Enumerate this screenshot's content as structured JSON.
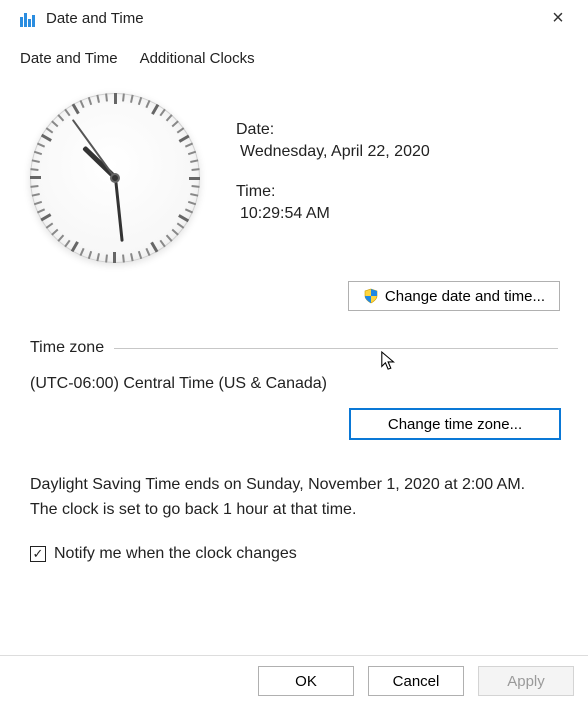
{
  "window": {
    "title": "Date and Time"
  },
  "tabs": {
    "date_time": "Date and Time",
    "additional_clocks": "Additional Clocks"
  },
  "dt": {
    "date_label": "Date:",
    "date_value": "Wednesday, April 22, 2020",
    "time_label": "Time:",
    "time_value": "10:29:54 AM"
  },
  "buttons": {
    "change_dt": "Change date and time...",
    "change_tz": "Change time zone...",
    "ok": "OK",
    "cancel": "Cancel",
    "apply": "Apply"
  },
  "timezone": {
    "section_label": "Time zone",
    "value": "(UTC-06:00) Central Time (US & Canada)"
  },
  "dst": {
    "line1": "Daylight Saving Time ends on Sunday, November 1, 2020 at 2:00 AM.",
    "line2": "The clock is set to go back 1 hour at that time."
  },
  "notify": {
    "label": "Notify me when the clock changes",
    "checked": true
  },
  "clock": {
    "hour_angle": 314,
    "minute_angle": 174,
    "second_angle": 324
  }
}
